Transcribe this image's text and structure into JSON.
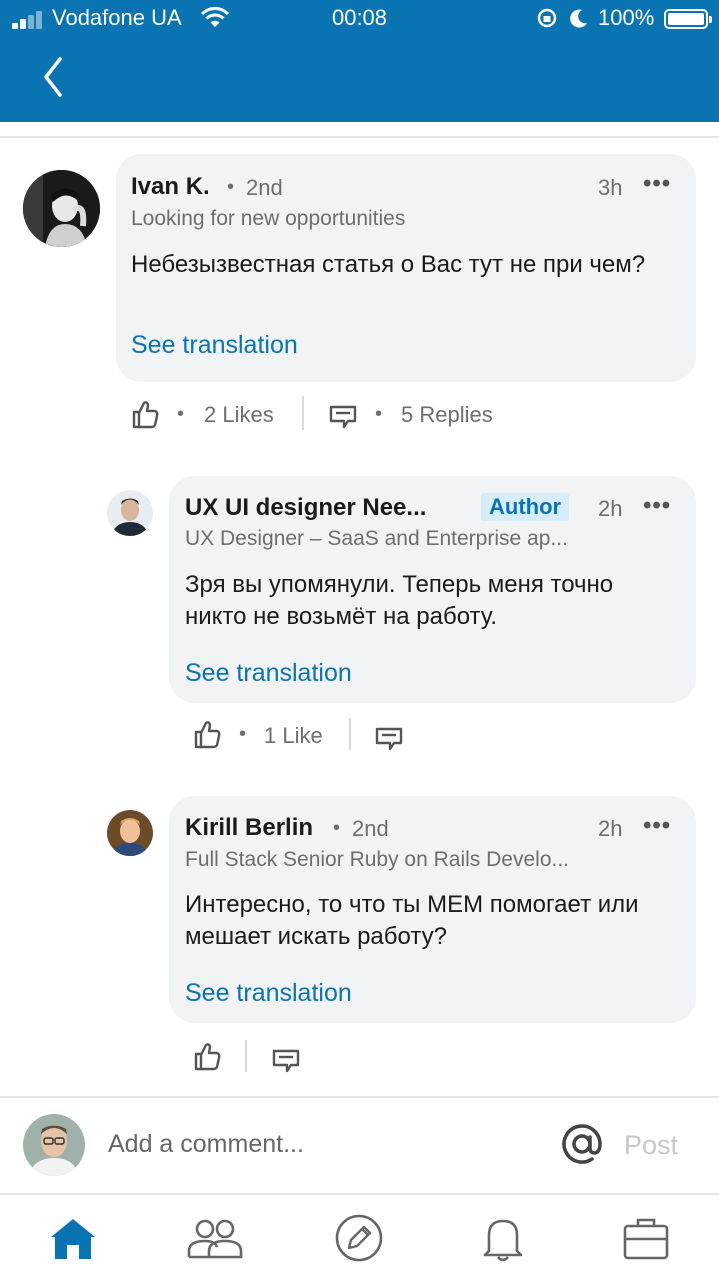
{
  "status_bar": {
    "carrier": "Vodafone UA",
    "time": "00:08",
    "battery": "100%"
  },
  "comments": [
    {
      "name": "Ivan K.",
      "degree": "2nd",
      "time": "3h",
      "headline": "Looking for new opportunities",
      "text": "Небезызвестная статья о Вас тут не при чем?",
      "translate": "See translation",
      "likes": "2 Likes",
      "replies": "5 Replies"
    },
    {
      "name": "UX UI designer Nee...",
      "badge": "Author",
      "time": "2h",
      "headline": "UX Designer – SaaS and Enterprise ap...",
      "text": "Зря вы упомянули. Теперь меня точно никто не возьмёт на работу.",
      "translate": "See translation",
      "likes": "1 Like"
    },
    {
      "name": "Kirill Berlin",
      "degree": "2nd",
      "time": "2h",
      "headline": "Full Stack Senior Ruby on Rails Develo...",
      "text": "Интересно, то что ты МЕМ помогает или мешает искать работу?",
      "translate": "See translation"
    }
  ],
  "comment_bar": {
    "placeholder": "Add a comment...",
    "post": "Post"
  },
  "bottom_nav": [
    {
      "icon": "home-icon",
      "active": true
    },
    {
      "icon": "network-icon"
    },
    {
      "icon": "post-icon"
    },
    {
      "icon": "notifications-icon"
    },
    {
      "icon": "jobs-icon"
    }
  ],
  "colors": {
    "brand": "#0a73b1",
    "bubble": "#f1f3f5",
    "muted": "#6e6e6e"
  }
}
